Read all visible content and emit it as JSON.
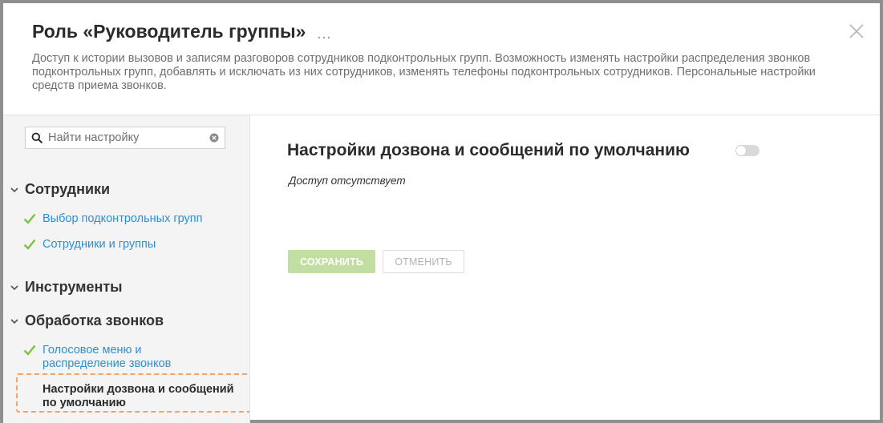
{
  "header": {
    "title": "Роль «Руководитель группы»",
    "more_label": "...",
    "description": "Доступ к истории вызовов и записям разговоров сотрудников подконтрольных групп. Возможность изменять настройки распределения звонков подконтрольных групп, добавлять и исключать из них сотрудников, изменять телефоны подконтрольных сотрудников. Персональные настройки средств приема звонков."
  },
  "sidebar": {
    "search_placeholder": "Найти настройку",
    "groups": [
      {
        "title": "Сотрудники",
        "items": [
          {
            "label": "Выбор подконтрольных групп",
            "checked": true
          },
          {
            "label": "Сотрудники и группы",
            "checked": true
          }
        ]
      },
      {
        "title": "Инструменты",
        "items": []
      },
      {
        "title": "Обработка звонков",
        "items": [
          {
            "label": "Голосовое меню и распределение звонков",
            "checked": true
          },
          {
            "label": "Настройки дозвона и сообщений по умолчанию",
            "checked": false,
            "active": true
          }
        ]
      }
    ]
  },
  "main": {
    "title": "Настройки дозвона и сообщений по умолчанию",
    "toggle_on": false,
    "access_note": "Доступ отсутствует",
    "save_label": "СОХРАНИТЬ",
    "cancel_label": "ОТМЕНИТЬ"
  },
  "colors": {
    "link": "#2d8fd5",
    "check": "#7cc242",
    "save_disabled": "#c2dfa1",
    "highlight": "#f0a36a"
  }
}
